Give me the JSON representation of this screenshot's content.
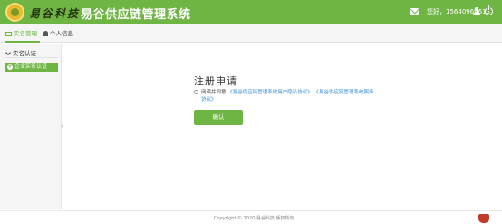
{
  "header": {
    "logo_text": "易谷科技",
    "app_title": "易谷供应链管理系统",
    "user_greeting": "您好，15640969613",
    "icons": [
      "mail-icon",
      "user-icon",
      "power-icon"
    ]
  },
  "subnav": {
    "tabs": [
      {
        "label": "实名管理",
        "active": true
      },
      {
        "label": "个人信息",
        "active": false
      }
    ]
  },
  "sidebar": {
    "section_label": "实名认证",
    "items": [
      {
        "label": "企业实名认证",
        "active": true
      }
    ],
    "collapse_glyph": "‹"
  },
  "main": {
    "title": "注册申请",
    "agree_prefix": "阅读并同意",
    "link_user_agreement": "《易谷供应链管理系统用户隐私协议》",
    "link_service_agreement": "《易谷供应链管理系统服务协议》",
    "confirm_label": "确认"
  },
  "footer": {
    "copyright": "Copyright © 2020 易谷科技 版权所有"
  },
  "colors": {
    "brand_green": "#6fb544",
    "link_blue": "#3a8fd6"
  }
}
